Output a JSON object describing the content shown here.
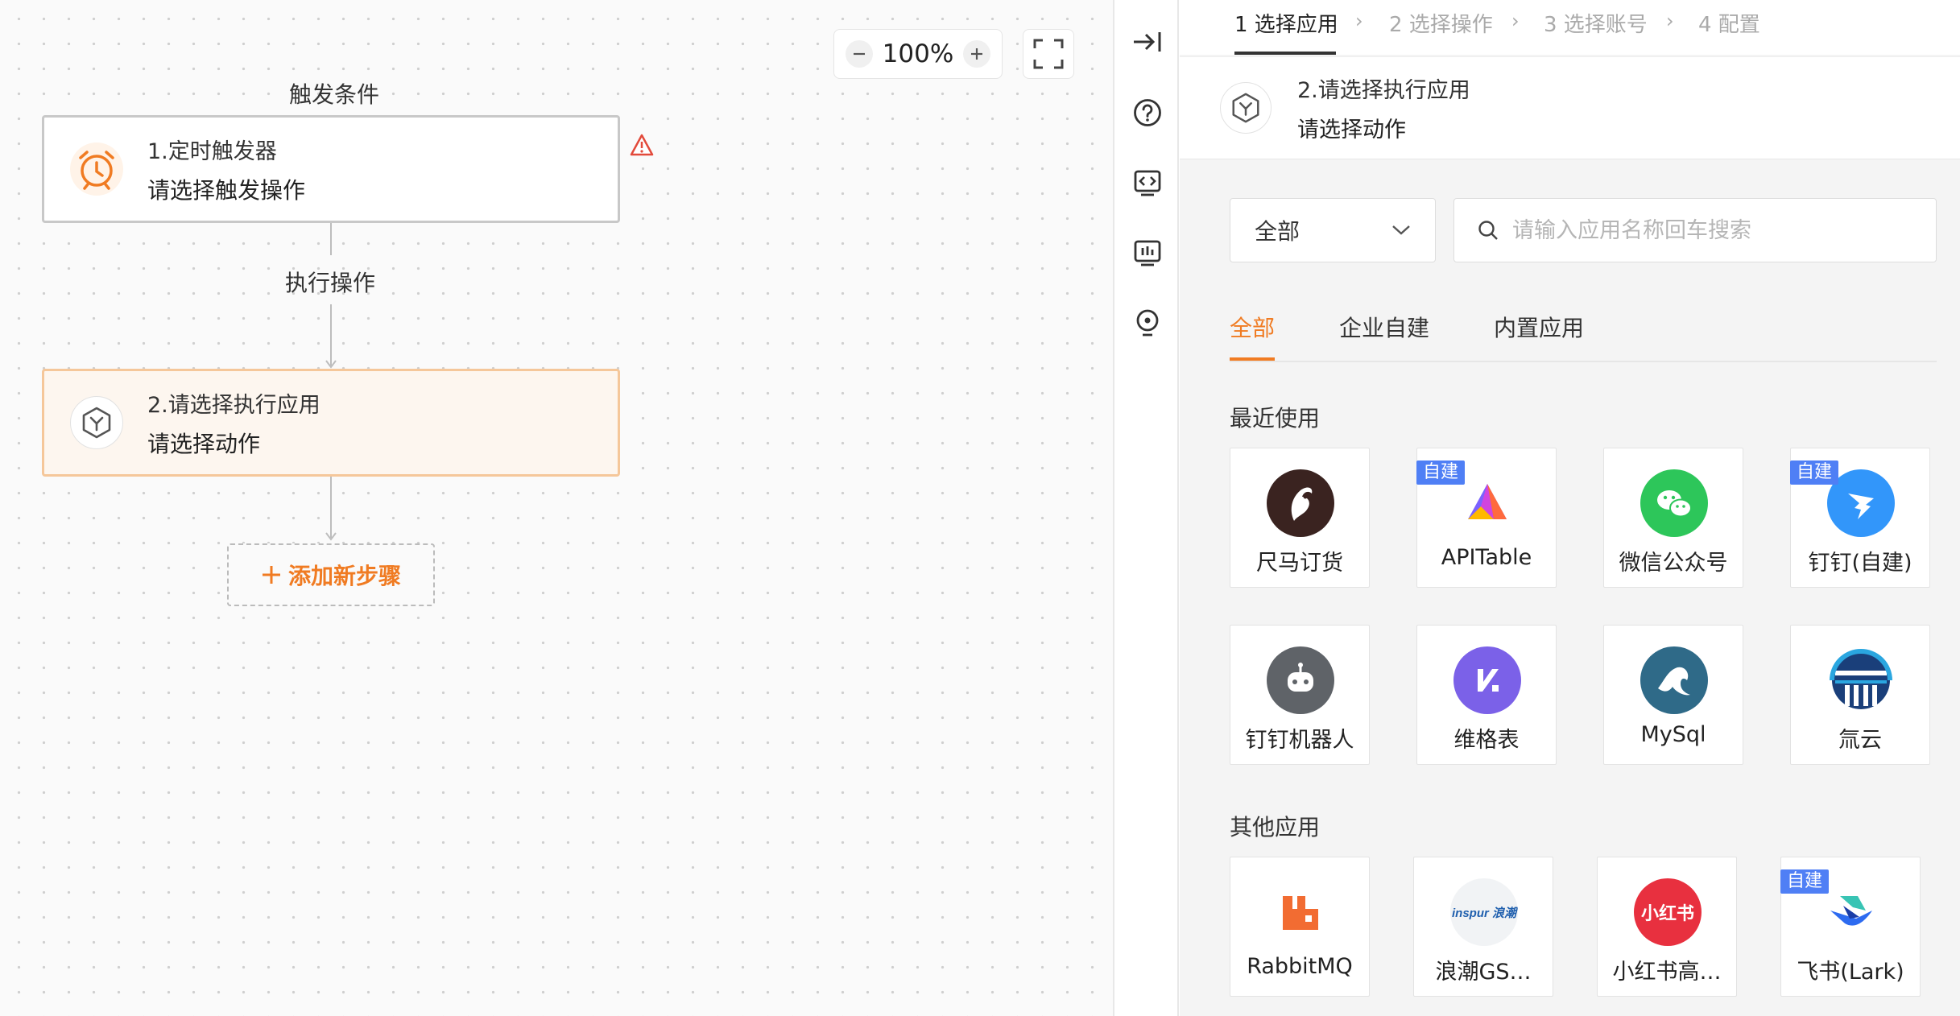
{
  "canvas": {
    "zoom": "100%",
    "trigger_label": "触发条件",
    "action_label": "执行操作",
    "node1": {
      "title": "1.定时触发器",
      "subtitle": "请选择触发操作"
    },
    "node2": {
      "title": "2.请选择执行应用",
      "subtitle": "请选择动作"
    },
    "add_step": "添加新步骤"
  },
  "steps": [
    {
      "label": "1 选择应用",
      "active": true
    },
    {
      "label": "2 选择操作",
      "active": false
    },
    {
      "label": "3 选择账号",
      "active": false
    },
    {
      "label": "4 配置",
      "active": false
    }
  ],
  "selected": {
    "title": "2.请选择执行应用",
    "subtitle": "请选择动作"
  },
  "filter": {
    "value": "全部"
  },
  "search": {
    "placeholder": "请输入应用名称回车搜索"
  },
  "tabs": [
    "全部",
    "企业自建",
    "内置应用"
  ],
  "recent": {
    "title": "最近使用",
    "apps": [
      {
        "name": "尺马订货",
        "badge": "",
        "icon": "horse-logo-icon",
        "color": "#3a2320"
      },
      {
        "name": "APITable",
        "badge": "自建",
        "icon": "apitable-logo-icon",
        "color": "#7b61ff"
      },
      {
        "name": "微信公众号",
        "badge": "",
        "icon": "wechat-logo-icon",
        "color": "#2dc65a"
      },
      {
        "name": "钉钉(自建)",
        "badge": "自建",
        "icon": "dingtalk-logo-icon",
        "color": "#3296fa"
      },
      {
        "name": "钉钉机器人",
        "badge": "",
        "icon": "robot-logo-icon",
        "color": "#5f6368"
      },
      {
        "name": "维格表",
        "badge": "",
        "icon": "vika-logo-icon",
        "color": "#7b61e8"
      },
      {
        "name": "MySql",
        "badge": "",
        "icon": "mysql-logo-icon",
        "color": "#2f6a88"
      },
      {
        "name": "氚云",
        "badge": "",
        "icon": "chuanyun-logo-icon",
        "color": "#1a3f7a"
      }
    ]
  },
  "other": {
    "title": "其他应用",
    "apps": [
      {
        "name": "RabbitMQ",
        "badge": "",
        "icon": "rabbitmq-logo-icon",
        "color": "#f26c32"
      },
      {
        "name": "浪潮GS…",
        "badge": "",
        "icon": "inspur-logo-icon",
        "color": "#1f5fae",
        "logo_text": "inspur 浪潮"
      },
      {
        "name": "小红书高…",
        "badge": "",
        "icon": "xiaohongshu-logo-icon",
        "color": "#e8303f",
        "logo_text": "小红书"
      },
      {
        "name": "飞书(Lark)",
        "badge": "自建",
        "icon": "feishu-logo-icon",
        "color": "#2d6bf0"
      }
    ]
  },
  "colors": {
    "accent": "#f07b22",
    "badge": "#4f7ff5",
    "warning": "#e24a3b"
  }
}
